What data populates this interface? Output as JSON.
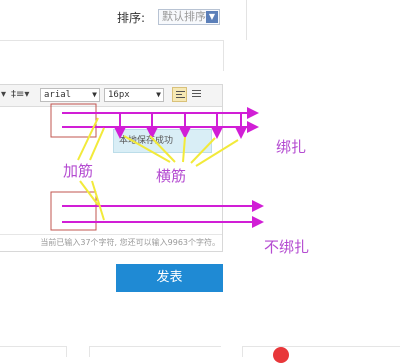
{
  "sort": {
    "label": "排序:",
    "selected": "默认排序"
  },
  "editor": {
    "font_family_value": "arial",
    "font_size_value": "16px",
    "toast_text": "本地保存成功",
    "counter_text": "当前已输入37个字符, 您还可以输入9963个字符。"
  },
  "submit_label": "发表",
  "annotations": {
    "jiajin": "加筋",
    "hengjin": "横筋",
    "bangzha": "绑扎",
    "bubangzha": "不绑扎"
  },
  "colors": {
    "annotation": "#b44bd1",
    "arrow": "#d11ed6",
    "pointer": "#f2ea3a",
    "box": "#c2554f",
    "submit_bg": "#1f8ad4"
  }
}
